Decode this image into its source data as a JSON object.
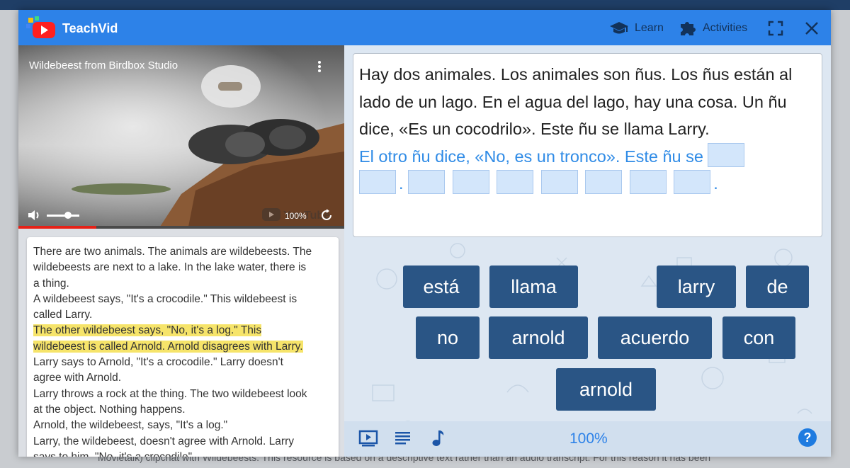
{
  "app": {
    "title": "TeachVid",
    "nav": {
      "learn": "Learn",
      "activities": "Activities"
    }
  },
  "video": {
    "title": "Wildebeest from Birdbox Studio",
    "zoom": "100%",
    "progress": 0.24,
    "volume": 0.65
  },
  "transcript": {
    "lines": [
      "There are two animals. The animals are wildebeests. The",
      "wildebeests are next to a lake. In the lake water, there is",
      "a thing.",
      "A wildebeest says, \"It's a crocodile.\" This wildebeest is",
      "called Larry.",
      "The other wildebeest says, \"No, it's a log.\" This",
      "wildebeest is called Arnold. Arnold disagrees with Larry.",
      "Larry says to Arnold, \"It's a crocodile.\" Larry doesn't",
      "agree with Arnold.",
      "Larry throws a rock at the thing. The two wildebeest look",
      "at the object. Nothing happens.",
      "Arnold, the wildebeest, says, \"It's a log.\"",
      "Larry, the wildebeest, doesn't agree with Arnold. Larry",
      "says to him, \"No, it's a crocodile\""
    ]
  },
  "exercise": {
    "sentences": [
      "Hay dos animales. Los animales son ñus. Los ñus están al lado de un lago. En el agua del lago, hay una cosa. Un ñu dice, «Es un cocodrilo». Este ñu se llama Larry."
    ],
    "active_sentence": "El otro ñu dice, «No, es un tronco». Este ñu se",
    "period": "."
  },
  "word_bank": [
    "está",
    "llama",
    "larry",
    "de",
    "no",
    "arnold",
    "acuerdo",
    "con",
    "arnold"
  ],
  "bottom": {
    "zoom": "100%"
  },
  "backdrop": {
    "text": "Movietalk) clipchat with Wildebeests. This resource is based on a descriptive text rather than an audio transcript. For this reason it has been"
  },
  "colors": {
    "titlebar": "#2d82e8",
    "word_button": "#2a5585",
    "highlight": "#f6e46a",
    "active_text": "#2f8be6"
  }
}
